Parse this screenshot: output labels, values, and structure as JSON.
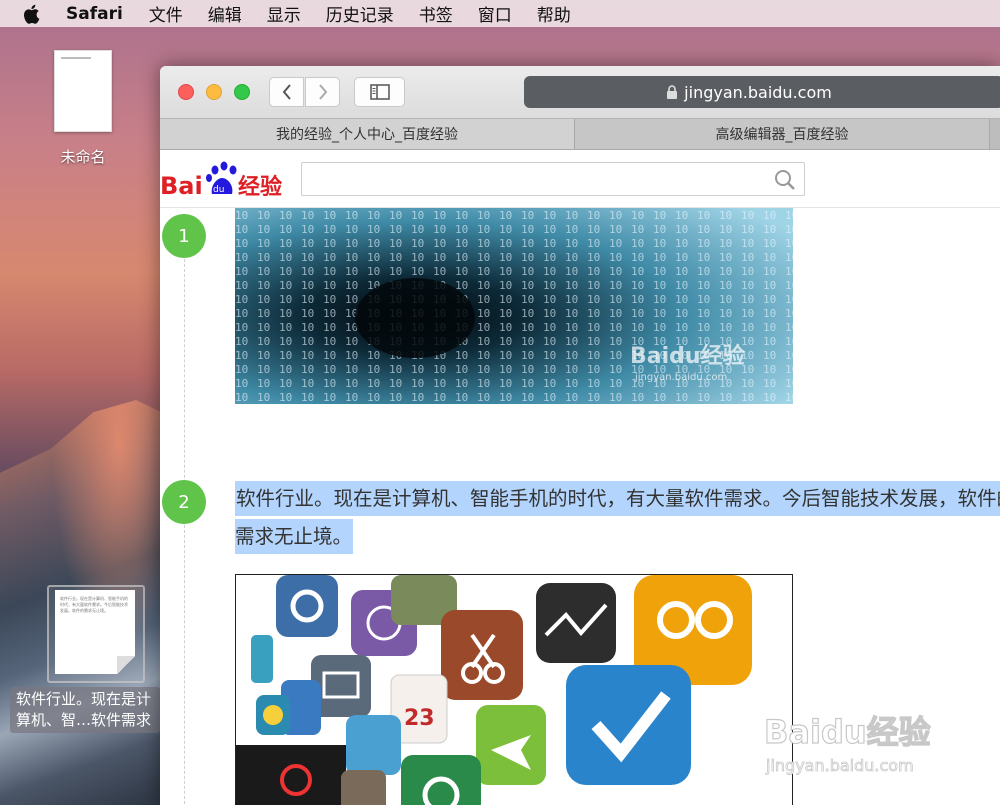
{
  "menubar": {
    "app": "Safari",
    "items": [
      "文件",
      "编辑",
      "显示",
      "历史记录",
      "书签",
      "窗口",
      "帮助"
    ]
  },
  "desktop": {
    "doc_label": "未命名",
    "file_label_line1": "软件行业。现在是计",
    "file_label_line2": "算机、智…软件需求"
  },
  "browser": {
    "url": "jingyan.baidu.com",
    "tabs": [
      {
        "label": "我的经验_个人中心_百度经验"
      },
      {
        "label": "高级编辑器_百度经验"
      }
    ],
    "logo_text": "Bai经验",
    "search_placeholder": ""
  },
  "content": {
    "steps": [
      {
        "number": "1"
      },
      {
        "number": "2",
        "text": "软件行业。现在是计算机、智能手机的时代，有大量软件需求。今后智能技术发展，软件的需求无止境。"
      }
    ],
    "image1_watermark": "Baidu经验",
    "image1_watermark_url": "jingyan.baidu.com",
    "page_watermark": "Baidu经验",
    "page_watermark_url": "jingyan.baidu.com"
  },
  "colors": {
    "step_badge": "#60c44a",
    "selection": "#b3d4fc",
    "baidu_red": "#de1f26",
    "baidu_blue": "#2319dc"
  }
}
